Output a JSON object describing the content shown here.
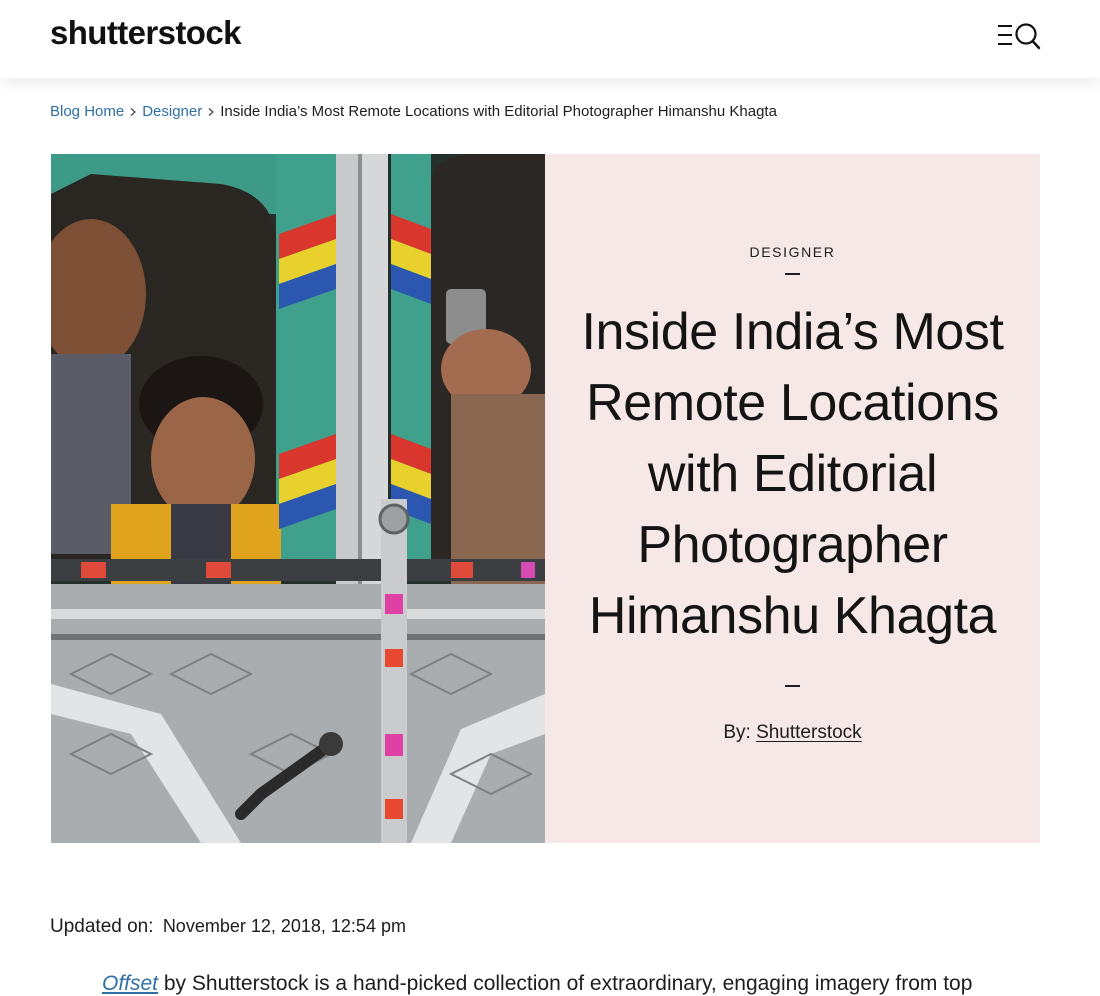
{
  "header": {
    "logo_text": "shutterstock",
    "menu_icon": "menu-search-icon"
  },
  "breadcrumb": {
    "items": [
      {
        "label": "Blog Home"
      },
      {
        "label": "Designer"
      }
    ],
    "current": "Inside India’s Most Remote Locations with Editorial Photographer Himanshu Khagta"
  },
  "hero": {
    "category": "DESIGNER",
    "title_lines": [
      "Inside India’s Most",
      "Remote Locations",
      "with Editorial",
      "Photographer",
      "Himanshu Khagta"
    ],
    "byline_prefix": "By:",
    "byline_author": "Shutterstock",
    "panel_color": "#f6e8e6"
  },
  "meta": {
    "updated_label": "Updated on:",
    "updated_date": "November 12, 2018, 12:54 pm"
  },
  "intro": {
    "link_text": "Offset",
    "text": " by Shutterstock is a hand-picked collection of extraordinary, engaging imagery from top"
  },
  "colors": {
    "link": "#2f6fa7",
    "text": "#1d1d1d"
  }
}
